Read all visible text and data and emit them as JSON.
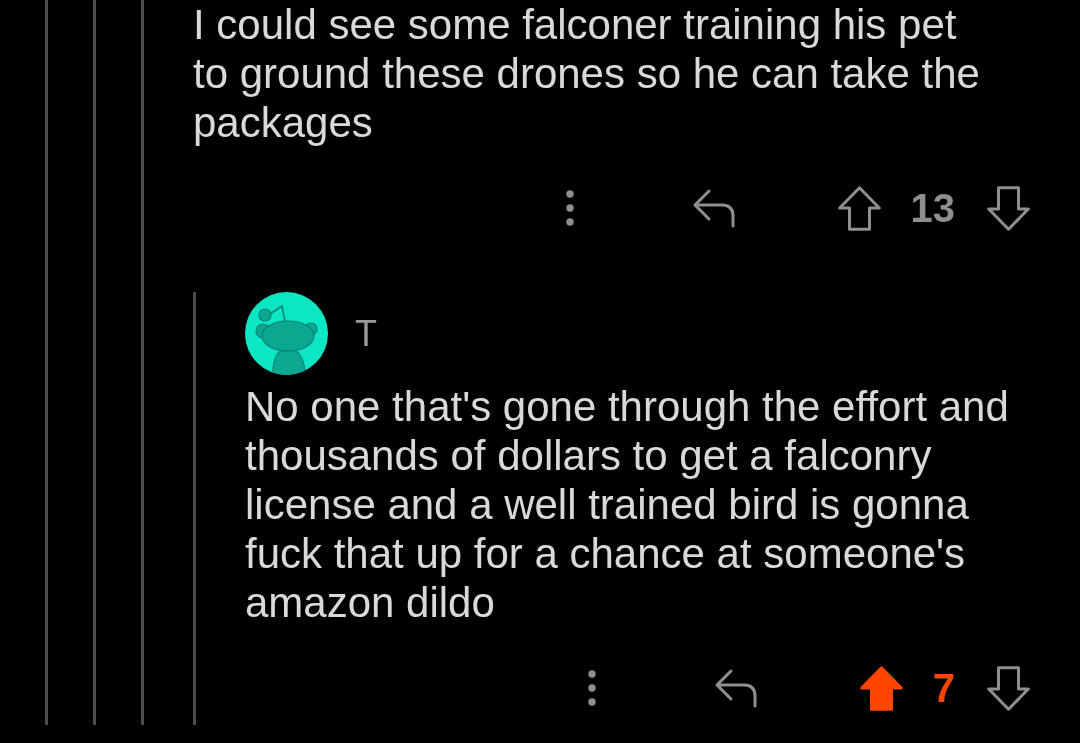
{
  "comments": [
    {
      "body": "I could see some falconer training his pet to ground these drones so he can take the packages",
      "score": "13",
      "upvoted": false,
      "downvoted": false,
      "replies": [
        {
          "author": "T",
          "body": "No one that's gone through the effort and thousands of dollars to get a falconry license and a well trained bird is gonna fuck that up for a chance at someone's amazon dildo",
          "score": "7",
          "upvoted": true,
          "downvoted": false
        }
      ]
    }
  ]
}
